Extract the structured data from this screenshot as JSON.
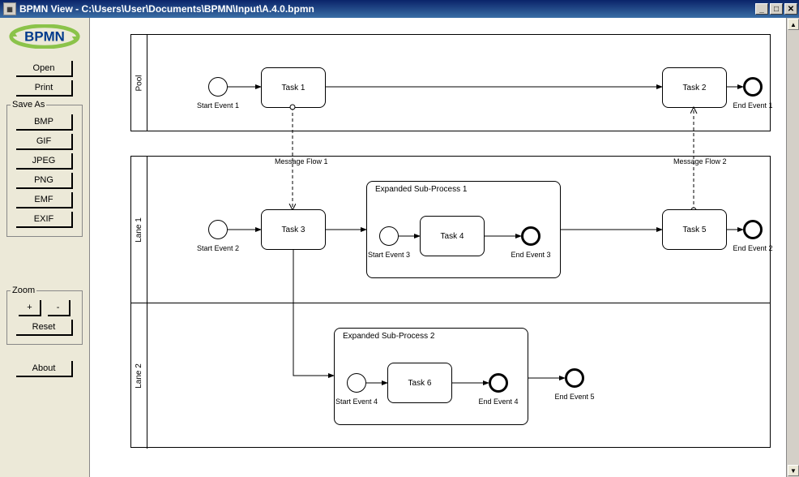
{
  "titlebar": {
    "title": "BPMN View - C:\\Users\\User\\Documents\\BPMN\\Input\\A.4.0.bpmn"
  },
  "logo": {
    "text": "BPMN"
  },
  "buttons": {
    "open": "Open",
    "print": "Print",
    "about": "About",
    "reset": "Reset",
    "zoom_in": "+",
    "zoom_out": "-"
  },
  "saveas": {
    "legend": "Save As",
    "bmp": "BMP",
    "gif": "GIF",
    "jpeg": "JPEG",
    "png": "PNG",
    "emf": "EMF",
    "exif": "EXIF"
  },
  "zoom": {
    "legend": "Zoom"
  },
  "pool1": {
    "label": "Pool"
  },
  "pool2": {
    "lane1": "Lane 1",
    "lane2": "Lane 2"
  },
  "events": {
    "start1": "Start Event 1",
    "start2": "Start Event 2",
    "start3": "Start Event 3",
    "start4": "Start Event 4",
    "end1": "End Event 1",
    "end2": "End Event 2",
    "end3": "End Event 3",
    "end4": "End Event 4",
    "end5": "End Event 5"
  },
  "tasks": {
    "t1": "Task 1",
    "t2": "Task 2",
    "t3": "Task 3",
    "t4": "Task 4",
    "t5": "Task 5",
    "t6": "Task 6"
  },
  "subprocs": {
    "sp1": "Expanded Sub-Process 1",
    "sp2": "Expanded Sub-Process 2"
  },
  "messages": {
    "m1": "Message Flow 1",
    "m2": "Message Flow 2"
  }
}
